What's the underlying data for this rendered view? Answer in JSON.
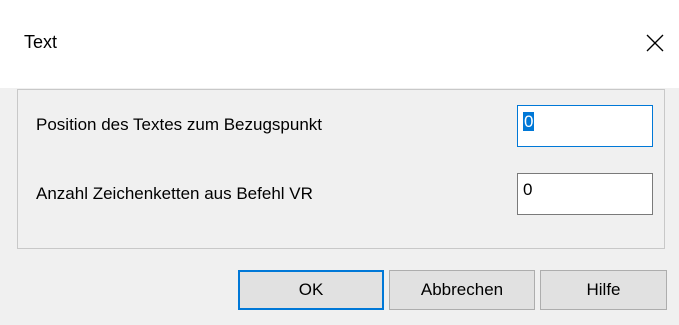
{
  "window": {
    "title": "Text",
    "close_icon": "close-icon"
  },
  "fields": [
    {
      "label": "Position des Textes zum Bezugspunkt",
      "value": "0"
    },
    {
      "label": "Anzahl Zeichenketten aus Befehl VR",
      "value": "0"
    }
  ],
  "buttons": {
    "ok": "OK",
    "cancel": "Abbrechen",
    "help": "Hilfe"
  },
  "colors": {
    "accent": "#0078d7",
    "dialog_bg": "#f0f0f0",
    "titlebar_bg": "#ffffff"
  }
}
